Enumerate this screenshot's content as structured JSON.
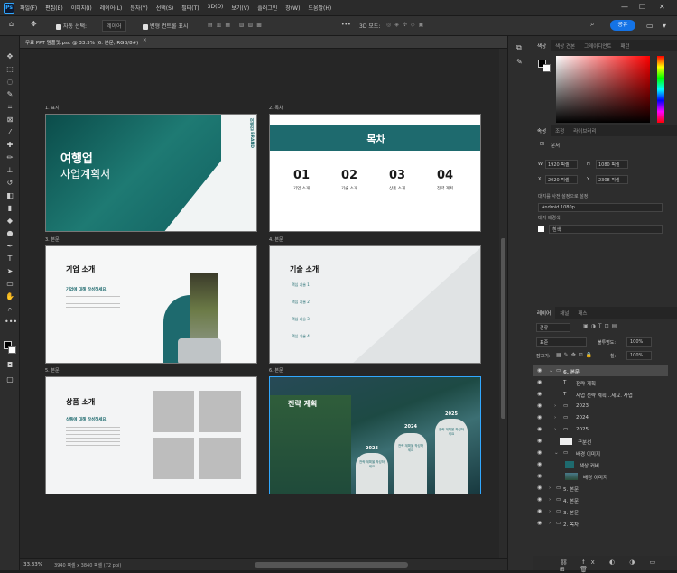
{
  "menu": [
    "파일(F)",
    "편집(E)",
    "이미지(I)",
    "레이어(L)",
    "문자(Y)",
    "선택(S)",
    "필터(T)",
    "3D(D)",
    "보기(V)",
    "플러그인",
    "창(W)",
    "도움말(H)"
  ],
  "options": {
    "auto_select": "자동 선택:",
    "layer_select": "레이어",
    "transform": "변형 컨트롤 표시",
    "more": "•••",
    "mode_3d": "3D 모드:",
    "share": "공유"
  },
  "doc_tab": "무료 PPT 템플릿.psd @ 33.3% (6. 본문, RGB/8#)",
  "status": {
    "zoom": "33.33%",
    "size": "3940 픽셀 x 3840 픽셀 (72 ppi)"
  },
  "slides": [
    {
      "label": "1. 표지",
      "title": "여행업",
      "subtitle": "사업계획서",
      "brand": "여행업 BRAND"
    },
    {
      "label": "2. 목차",
      "title": "목차",
      "items": [
        {
          "num": "01",
          "text": "기업 소개"
        },
        {
          "num": "02",
          "text": "기술 소개"
        },
        {
          "num": "03",
          "text": "상품 소개"
        },
        {
          "num": "04",
          "text": "전략 계획"
        }
      ]
    },
    {
      "label": "3. 본문",
      "title": "기업 소개",
      "sub": "기업에 대해 작성하세요"
    },
    {
      "label": "4. 본문",
      "title": "기술 소개",
      "items": [
        "핵심 기술 1",
        "핵심 기술 2",
        "핵심 기술 3",
        "핵심 기술 4"
      ]
    },
    {
      "label": "5. 본문",
      "title": "상품 소개",
      "sub": "상품에 대해 작성하세요"
    },
    {
      "label": "6. 본문",
      "title": "전략 계획",
      "years": [
        "2023",
        "2024",
        "2025"
      ],
      "card_text": "전략 계획을 작성하세요"
    }
  ],
  "color_panel": {
    "tabs": [
      "색상",
      "색상 견본",
      "그레이디언트",
      "패턴"
    ]
  },
  "properties": {
    "tabs": [
      "속성",
      "조정",
      "라이브러리"
    ],
    "doc": "문서",
    "w_label": "W",
    "w": "1920 픽셀",
    "h_label": "H",
    "h": "1080 픽셀",
    "x_label": "X",
    "x": "2020 픽셀",
    "y_label": "Y",
    "y": "2308 픽셀",
    "artboard_label": "대지를 사전 설정으로 설정:",
    "artboard_preset": "Android 1080p",
    "bg_label": "대지 배경색",
    "bg_value": "흰색"
  },
  "layers_panel": {
    "tabs": [
      "레이어",
      "채널",
      "패스"
    ],
    "filter": "종류",
    "blend": "표준",
    "opacity_label": "불투명도:",
    "opacity": "100%",
    "lock_label": "잠그기:",
    "fill_label": "칠:",
    "fill": "100%",
    "layers": [
      {
        "name": "6. 본문",
        "type": "folder",
        "selected": true
      },
      {
        "name": "전략 계획",
        "type": "text"
      },
      {
        "name": "사업 전략 계획...세요. 사업",
        "type": "text"
      },
      {
        "name": "2023",
        "type": "folder"
      },
      {
        "name": "2024",
        "type": "folder"
      },
      {
        "name": "2025",
        "type": "folder"
      },
      {
        "name": "구분선",
        "type": "img"
      },
      {
        "name": "배경 이미지",
        "type": "folder"
      },
      {
        "name": "색상 커버",
        "type": "img"
      },
      {
        "name": "배경 이미지",
        "type": "img"
      },
      {
        "name": "5. 본문",
        "type": "folder"
      },
      {
        "name": "4. 본문",
        "type": "folder"
      },
      {
        "name": "3. 본문",
        "type": "folder"
      },
      {
        "name": "2. 목차",
        "type": "folder"
      }
    ]
  },
  "colors": {
    "accent": "#1e6a6e",
    "share": "#1473e6"
  }
}
